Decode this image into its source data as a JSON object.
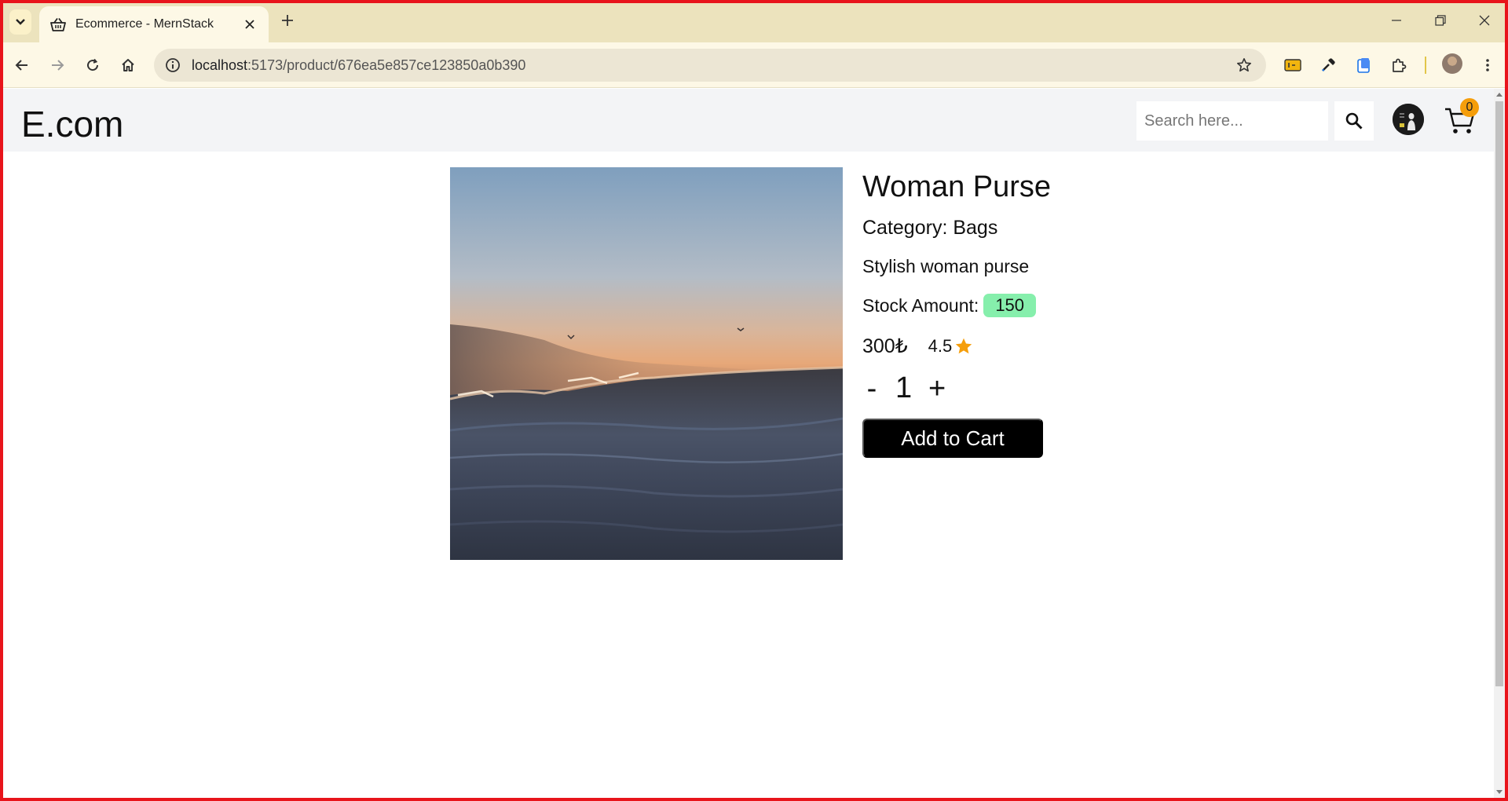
{
  "browser": {
    "tab_title": "Ecommerce - MernStack",
    "url_host": "localhost",
    "url_path": ":5173/product/676ea5e857ce123850a0b390"
  },
  "site": {
    "brand": "E.com",
    "search_placeholder": "Search here...",
    "cart_count": "0"
  },
  "product": {
    "name": "Woman Purse",
    "category": "Category: Bags",
    "description": "Stylish woman purse",
    "stock_label": "Stock Amount:",
    "stock_value": "150",
    "price": "300₺",
    "rating": "4.5",
    "quantity": "1",
    "qty_minus": "-",
    "qty_plus": "+",
    "add_to_cart": "Add to Cart"
  },
  "colors": {
    "stock_badge": "#86efac",
    "cart_badge": "#f59e0b",
    "star": "#f59e0b",
    "frame_border": "#e8141b"
  }
}
